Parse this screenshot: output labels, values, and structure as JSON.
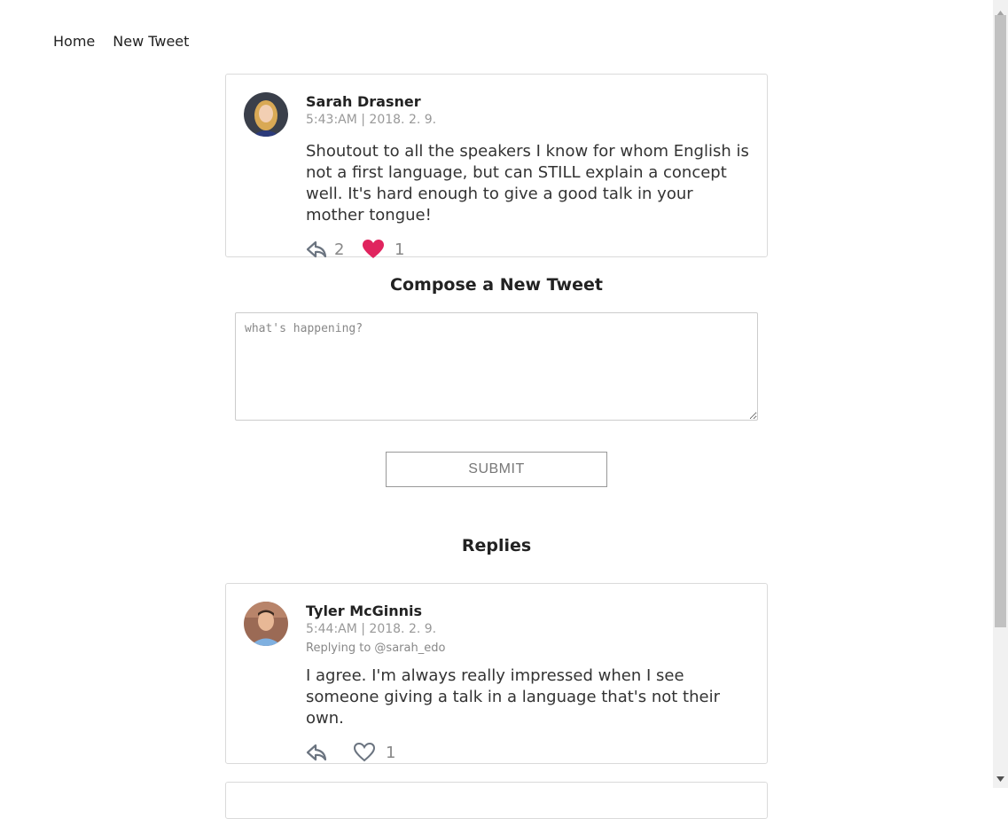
{
  "nav": {
    "home": "Home",
    "new_tweet": "New Tweet"
  },
  "tweet": {
    "name": "Sarah Drasner",
    "meta": "5:43:AM | 2018. 2. 9.",
    "text": "Shoutout to all the speakers I know for whom English is not a first language, but can STILL explain a concept well. It's hard enough to give a good talk in your mother tongue!",
    "reply_count": "2",
    "like_count": "1",
    "liked": true,
    "like_color": "#e0245e"
  },
  "compose": {
    "title": "Compose a New Tweet",
    "placeholder": "what's happening?",
    "value": "",
    "submit_label": "SUBMIT"
  },
  "replies": {
    "title": "Replies",
    "items": [
      {
        "name": "Tyler McGinnis",
        "meta": "5:44:AM | 2018. 2. 9.",
        "replying_to": "Replying to @sarah_edo",
        "text": "I agree. I'm always really impressed when I see someone giving a talk in a language that's not their own.",
        "reply_count": "",
        "like_count": "1",
        "liked": false
      }
    ]
  }
}
